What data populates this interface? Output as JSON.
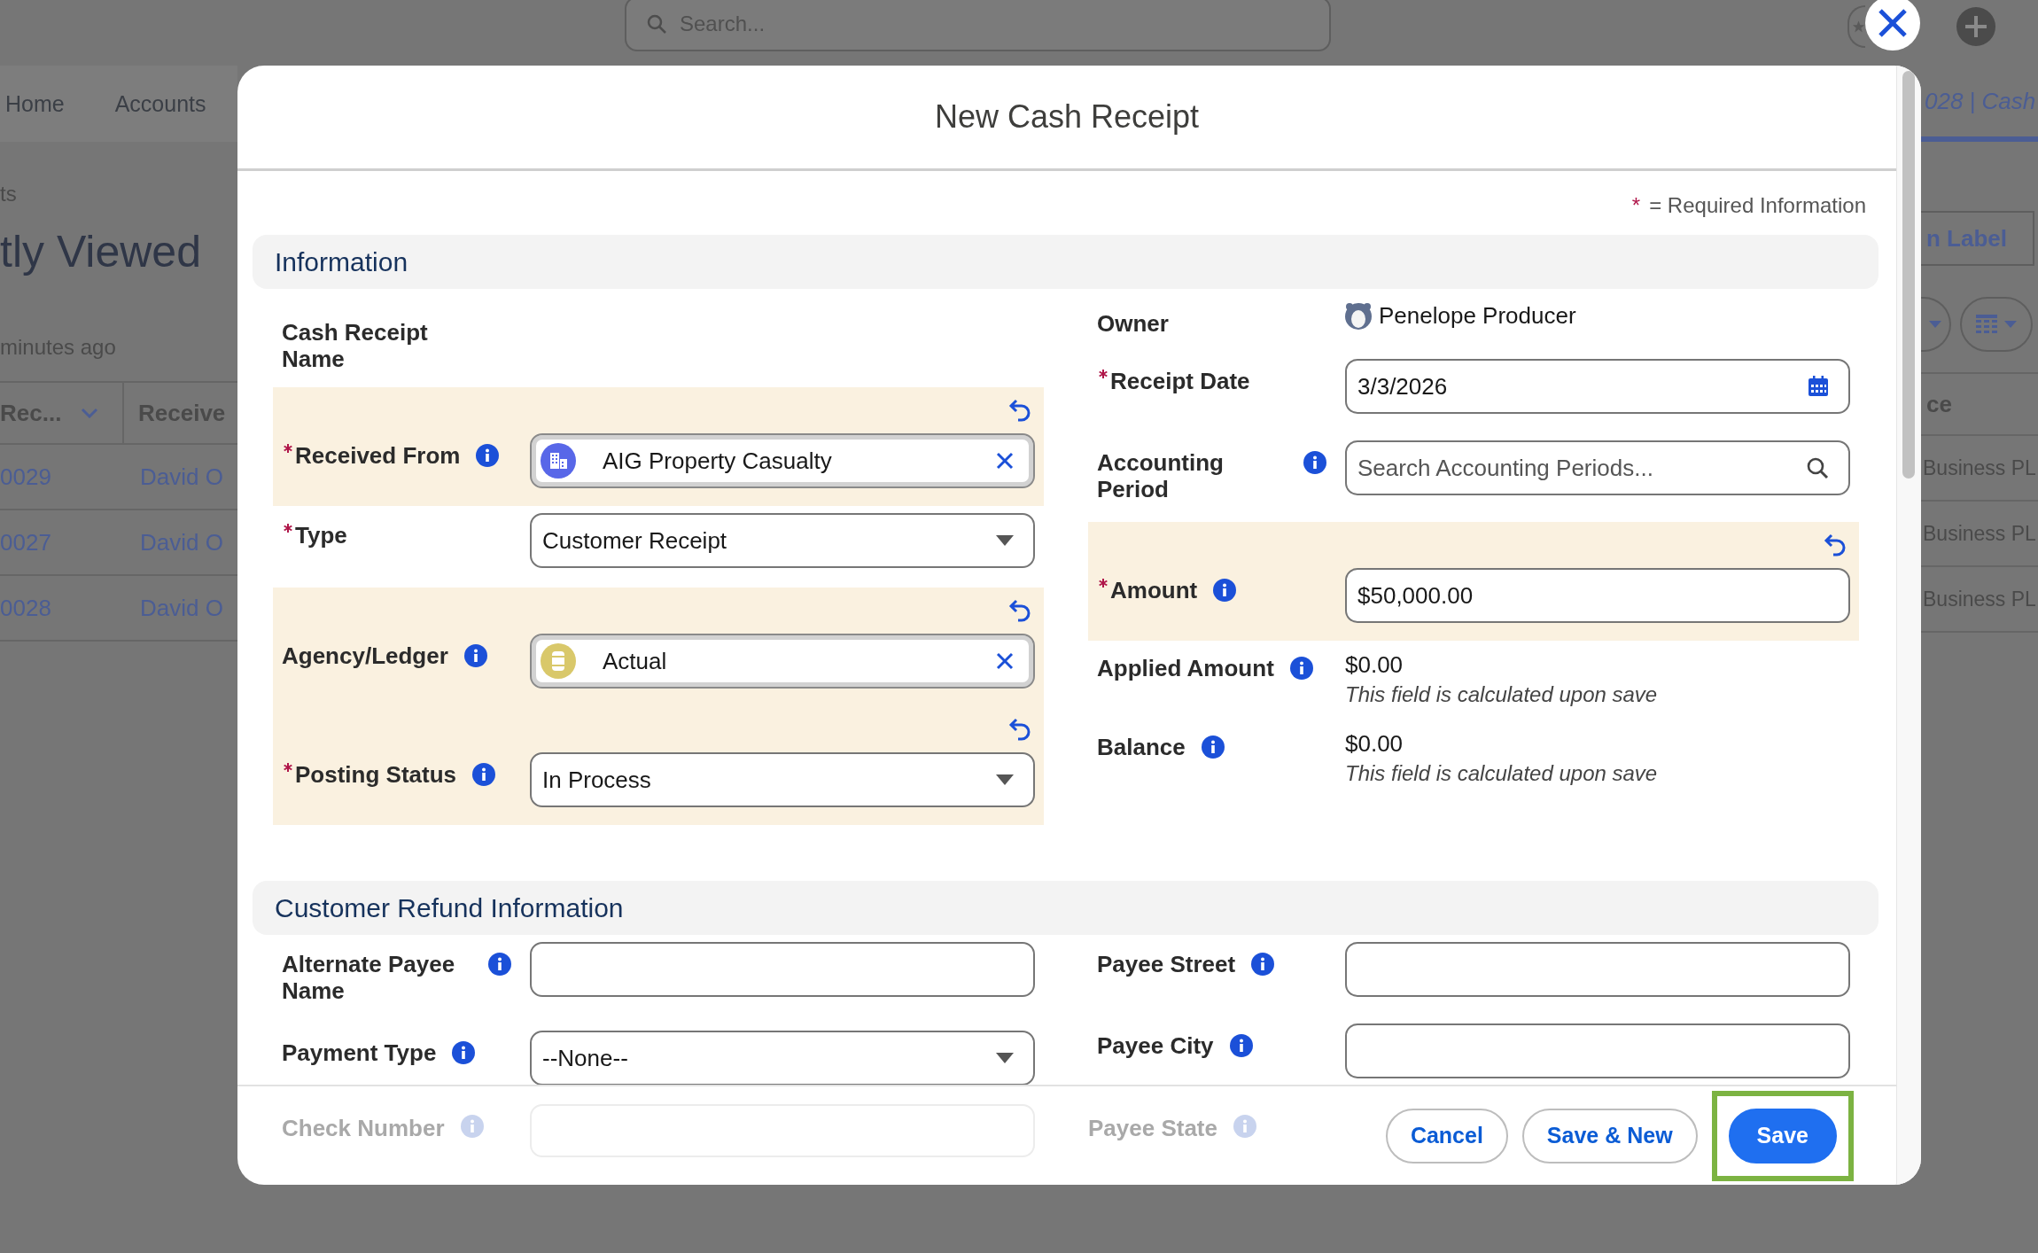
{
  "background": {
    "search": {
      "placeholder": "Search..."
    },
    "nav": [
      {
        "label": "Home"
      },
      {
        "label": "Accounts"
      }
    ],
    "open_tab": {
      "label": "028 | Cash",
      "selected": true
    },
    "breadcrumb": "ts",
    "list_title": "tly Viewed",
    "updated": "minutes ago",
    "label_button": "n Label",
    "table": {
      "columns": [
        "Rec...",
        "Receive",
        "ce"
      ],
      "rows": [
        {
          "name": "0029",
          "received": "David O",
          "column_3": "Business PL"
        },
        {
          "name": "0027",
          "received": "David O",
          "column_3": "Business PL"
        },
        {
          "name": "0028",
          "received": "David O",
          "column_3": "Business PL"
        }
      ]
    }
  },
  "modal": {
    "title": "New Cash Receipt",
    "required_legend": {
      "mark": "*",
      "text": "= Required Information"
    },
    "sections": [
      {
        "title": "Information",
        "left": [
          {
            "label": "Cash Receipt Name",
            "kind": "none",
            "required": false,
            "info": false,
            "changed": false
          },
          {
            "label": "Received From",
            "kind": "account",
            "value": "AIG Property Casualty",
            "required": true,
            "info": true,
            "changed": true
          },
          {
            "label": "Type",
            "kind": "picklist",
            "value": "Customer Receipt",
            "required": true,
            "info": false,
            "changed": false
          },
          {
            "label": "Agency/Ledger",
            "kind": "ledger",
            "value": "Actual",
            "required": false,
            "info": true,
            "changed": true
          },
          {
            "label": "Posting Status",
            "kind": "picklist",
            "value": "In Process",
            "required": true,
            "info": true,
            "changed": true
          }
        ],
        "right": [
          {
            "label": "Owner",
            "kind": "user",
            "value": "Penelope Producer",
            "required": false,
            "info": false,
            "changed": false
          },
          {
            "label": "Receipt Date",
            "kind": "date",
            "value": "3/3/2026",
            "required": true,
            "info": false,
            "changed": false
          },
          {
            "label": "Accounting Period",
            "kind": "search",
            "placeholder": "Search Accounting Periods...",
            "required": false,
            "info": true,
            "changed": false
          },
          {
            "label": "Amount",
            "kind": "text",
            "value": "$50,000.00",
            "required": true,
            "info": true,
            "changed": true
          },
          {
            "label": "Applied Amount",
            "kind": "readonly",
            "value": "$0.00",
            "note": "This field is calculated upon save",
            "required": false,
            "info": true,
            "changed": false
          },
          {
            "label": "Balance",
            "kind": "readonly",
            "value": "$0.00",
            "note": "This field is calculated upon save",
            "required": false,
            "info": true,
            "changed": false
          }
        ]
      },
      {
        "title": "Customer Refund Information",
        "left": [
          {
            "label": "Alternate Payee Name",
            "kind": "text",
            "required": false,
            "info": true,
            "changed": false
          },
          {
            "label": "Payment Type",
            "kind": "picklist",
            "value": "--None--",
            "required": false,
            "info": true,
            "changed": false
          }
        ],
        "right": [
          {
            "label": "Payee Street",
            "kind": "text",
            "required": false,
            "info": true,
            "changed": false
          },
          {
            "label": "Payee City",
            "kind": "text",
            "required": false,
            "info": true,
            "changed": false
          }
        ]
      }
    ],
    "obscured_fields": [
      {
        "label": "Check Number",
        "info": true,
        "kind": "text"
      },
      {
        "label": "Payee State",
        "info": true,
        "kind": "none"
      }
    ],
    "buttons": [
      {
        "label": "Cancel",
        "kind": "neutral",
        "highlighted": false
      },
      {
        "label": "Save & New",
        "kind": "neutral",
        "highlighted": false
      },
      {
        "label": "Save",
        "kind": "brand",
        "highlighted": true
      }
    ]
  }
}
